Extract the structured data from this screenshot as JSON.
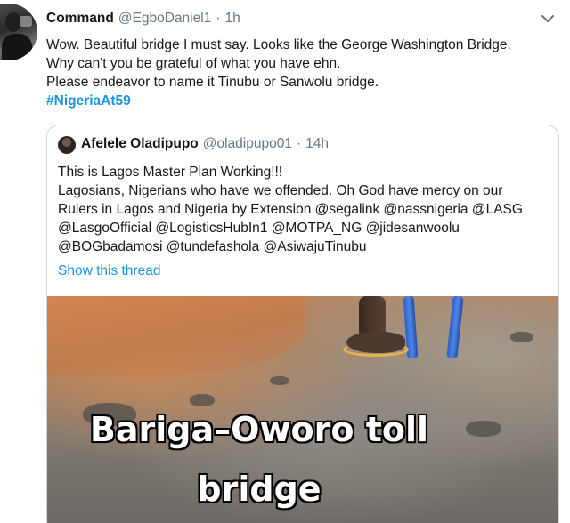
{
  "tweet": {
    "author_name": "Command",
    "author_handle": "@EgboDaniel1",
    "separator": "·",
    "time": "1h",
    "lines": [
      "Wow. Beautiful bridge I must say. Looks like the George Washington Bridge.",
      "Why can't you be grateful of what you have ehn.",
      "Please endeavor to name it Tinubu or Sanwolu bridge."
    ],
    "hashtag": "#NigeriaAt59"
  },
  "quoted_tweet": {
    "author_name": "Afelele Oladipupo",
    "author_handle": "@oladipupo01",
    "separator": "·",
    "time": "14h",
    "lines": [
      "This is Lagos Master Plan Working!!!",
      "Lagosians, Nigerians who have we offended. Oh God have mercy on our",
      "Rulers in Lagos and Nigeria by Extension @segalink @nassnigeria @LASG",
      "@LasgoOfficial @LogisticsHubIn1 @MOTPA_NG @jidesanwoolu",
      " @BOGbadamosi @tundefashola @AsiwajuTinubu"
    ],
    "show_thread": "Show this thread",
    "media_caption_line1": "Bariga–Oworo toll",
    "media_caption_line2": "bridge"
  },
  "icons": {
    "caret": "chevron-down-icon"
  },
  "colors": {
    "link": "#1b95e0",
    "secondary_text": "#657786",
    "border": "#ccd6dd"
  }
}
